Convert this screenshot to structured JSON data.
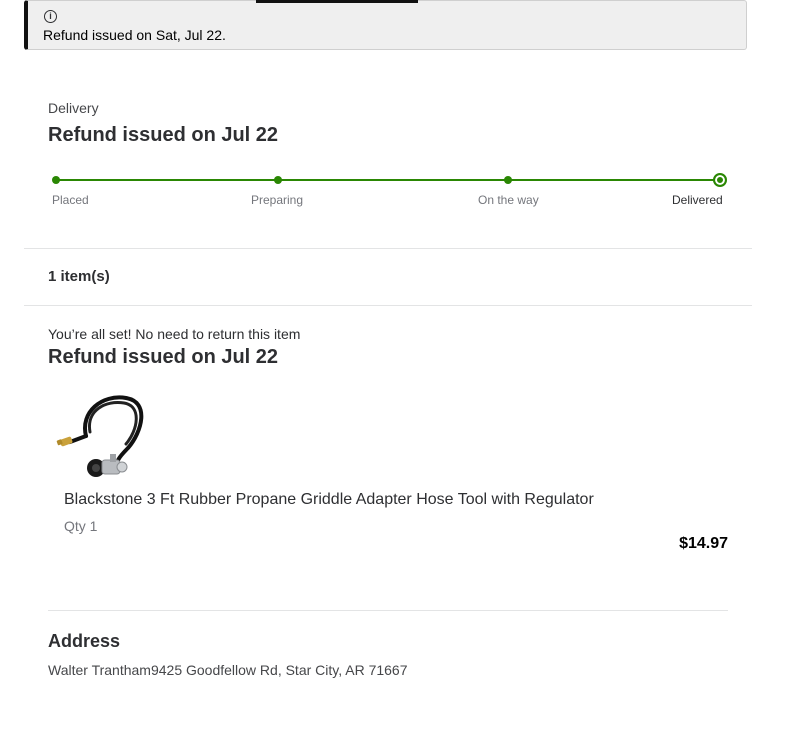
{
  "alert": {
    "icon": "info-icon",
    "icon_glyph": "i",
    "message": "Refund issued on Sat, Jul 22."
  },
  "delivery": {
    "label": "Delivery",
    "title": "Refund issued on Jul 22",
    "accent_color": "#2a8703",
    "steps": [
      {
        "label": "Placed"
      },
      {
        "label": "Preparing"
      },
      {
        "label": "On the way"
      },
      {
        "label": "Delivered"
      }
    ],
    "current_step": "Delivered"
  },
  "items": {
    "count_label": "1 item(s)",
    "return_note": "You’re all set! No need to return this item",
    "refund_title": "Refund issued on Jul 22",
    "list": [
      {
        "name": "Blackstone 3 Ft Rubber Propane Griddle Adapter Hose Tool with Regulator",
        "qty": "Qty 1",
        "price": "$14.97"
      }
    ]
  },
  "address": {
    "title": "Address",
    "text": "Walter Trantham9425 Goodfellow Rd, Star City, AR 71667"
  }
}
